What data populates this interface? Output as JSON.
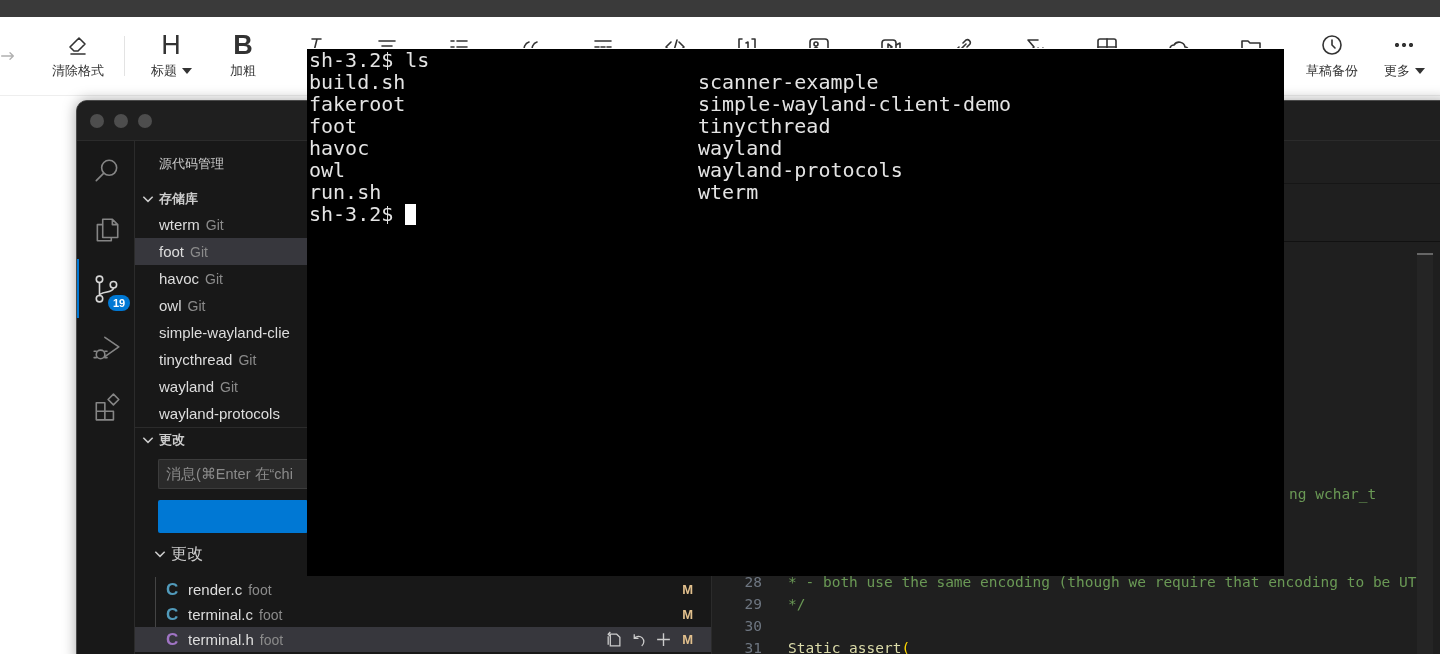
{
  "toolbar": {
    "items": [
      {
        "kind": "redo",
        "disabled": true
      },
      {
        "kind": "eraser",
        "label": "清除格式",
        "disabled": false
      },
      {
        "kind": "heading",
        "glyph": "H",
        "label": "标题",
        "dropdown": true,
        "disabled": false
      },
      {
        "kind": "bold",
        "glyph": "B",
        "label": "加粗",
        "disabled": false
      },
      {
        "kind": "italic",
        "disabled": false
      },
      {
        "kind": "align",
        "disabled": false
      },
      {
        "kind": "list",
        "disabled": false
      },
      {
        "kind": "quote",
        "disabled": false
      },
      {
        "kind": "rule",
        "disabled": false
      },
      {
        "kind": "code",
        "disabled": false
      },
      {
        "kind": "footnote",
        "disabled": false
      },
      {
        "kind": "image",
        "disabled": false
      },
      {
        "kind": "video",
        "disabled": false
      },
      {
        "kind": "link",
        "disabled": false
      },
      {
        "kind": "formula",
        "disabled": false
      },
      {
        "kind": "table",
        "disabled": false
      },
      {
        "kind": "cloud",
        "disabled": false
      },
      {
        "kind": "folder",
        "disabled": false
      }
    ],
    "right_items": [
      {
        "kind": "clock",
        "label": "草稿备份",
        "disabled": false
      },
      {
        "kind": "more",
        "label": "更多",
        "dropdown": true,
        "disabled": false
      }
    ]
  },
  "editor_window": {
    "activity_bar": [
      {
        "kind": "search",
        "selected": false
      },
      {
        "kind": "files",
        "selected": false
      },
      {
        "kind": "source-control",
        "selected": true,
        "badge": "19"
      },
      {
        "kind": "debug",
        "selected": false
      },
      {
        "kind": "extensions",
        "selected": false
      }
    ],
    "sidebar": {
      "title": "源代码管理",
      "repositories": {
        "title": "存储库",
        "expanded": true,
        "items": [
          {
            "name": "wterm",
            "provider": "Git",
            "selected": false
          },
          {
            "name": "foot",
            "provider": "Git",
            "selected": true
          },
          {
            "name": "havoc",
            "provider": "Git",
            "selected": false
          },
          {
            "name": "owl",
            "provider": "Git",
            "selected": false
          },
          {
            "name": "simple-wayland-clie",
            "selected": false
          },
          {
            "name": "tinycthread",
            "provider": "Git",
            "selected": false
          },
          {
            "name": "wayland",
            "provider": "Git",
            "selected": false
          },
          {
            "name": "wayland-protocols",
            "selected": false
          }
        ]
      },
      "changes": {
        "title": "更改",
        "expanded": true,
        "message": {
          "placeholder": "消息(⌘Enter 在“chi"
        },
        "group": {
          "title": "更改",
          "expanded": true,
          "files": [
            {
              "icon": "C",
              "color": "#519aba",
              "name": "render.c",
              "folder": "foot",
              "status": "M",
              "selected": false
            },
            {
              "icon": "C",
              "color": "#519aba",
              "name": "terminal.c",
              "folder": "foot",
              "status": "M",
              "selected": false
            },
            {
              "icon": "C",
              "color": "#a074c4",
              "name": "terminal.h",
              "folder": "foot",
              "status": "M",
              "selected": true
            }
          ]
        }
      }
    },
    "code": [
      {
        "kind": "clipped",
        "tokens": [
          {
            "kind": "comment",
            "text": "ng wchar_t"
          }
        ]
      },
      {
        "kind": "hidden"
      },
      {
        "kind": "hidden"
      },
      {
        "kind": "hidden"
      },
      {
        "kind": "line",
        "number": "28",
        "tokens": [
          {
            "kind": "comment",
            "text": "* - both use the same encoding (though we require that encoding to be UT"
          }
        ]
      },
      {
        "kind": "line",
        "number": "29",
        "tokens": [
          {
            "kind": "comment",
            "text": "*/"
          }
        ]
      },
      {
        "kind": "line",
        "number": "30"
      },
      {
        "kind": "line",
        "number": "31",
        "tokens": [
          {
            "kind": "function",
            "text": "Static assert"
          },
          {
            "kind": "bracket",
            "text": "("
          }
        ]
      }
    ]
  },
  "terminal": {
    "lines": [
      {
        "kind": "command",
        "left": "sh-3.2$ ls"
      },
      {
        "kind": "output",
        "left": "build.sh",
        "right": "scanner-example"
      },
      {
        "kind": "output",
        "left": "fakeroot",
        "right": "simple-wayland-client-demo"
      },
      {
        "kind": "output",
        "left": "foot",
        "right": "tinycthread"
      },
      {
        "kind": "output",
        "left": "havoc",
        "right": "wayland"
      },
      {
        "kind": "output",
        "left": "owl",
        "right": "wayland-protocols"
      },
      {
        "kind": "output",
        "left": "run.sh",
        "right": "wterm"
      },
      {
        "kind": "prompt",
        "left": "sh-3.2$"
      }
    ]
  }
}
